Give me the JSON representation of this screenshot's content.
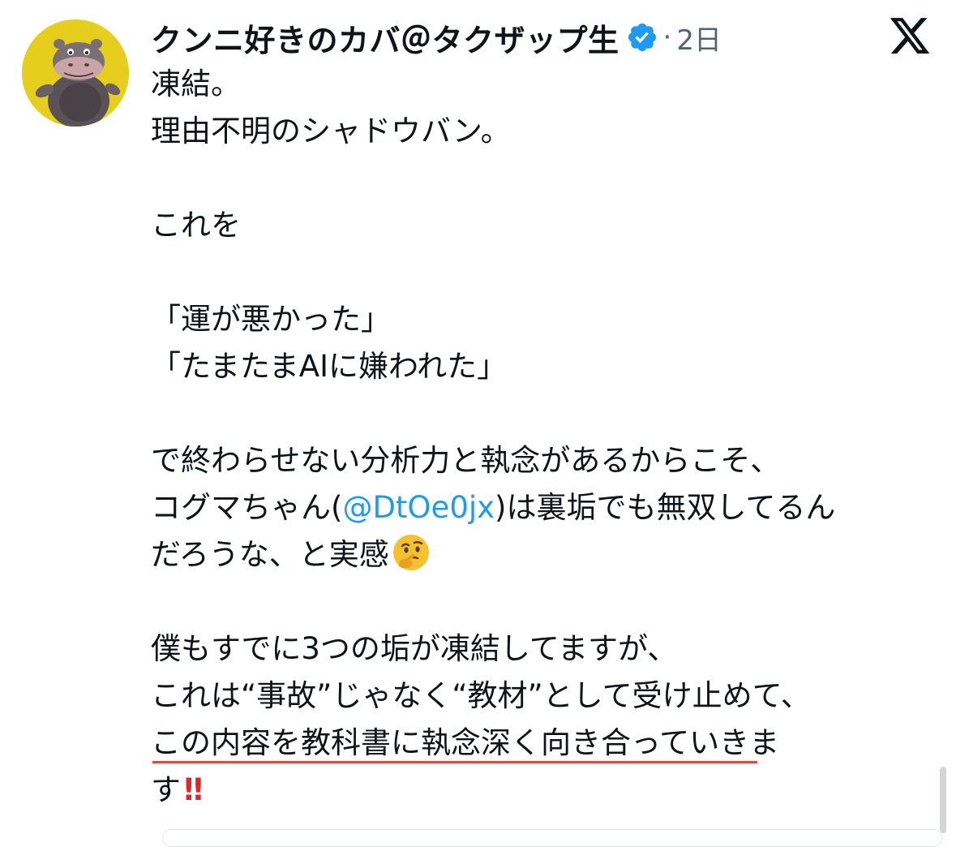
{
  "author": {
    "display_name": "クンニ好きのカバ＠タクザップ生",
    "verified_icon": "verified-badge-icon",
    "avatar_icon": "hippo-avatar"
  },
  "meta": {
    "separator": "·",
    "time": "2日"
  },
  "brand": {
    "logo_icon": "x-logo-icon"
  },
  "tweet": {
    "lines": [
      "凍結。",
      "理由不明のシャドウバン。",
      "",
      "これを",
      "",
      "「運が悪かった」",
      "「たまたまAIに嫌われた」",
      "",
      "で終わらせない分析力と執念があるからこそ、",
      "",
      "だろうな、と実感",
      "",
      "僕もすでに3つの垢が凍結してますが、",
      "これは“事故”じゃなく“教材”として受け止めて、",
      "この内容を教科書に執念深く向き合っていきま",
      "す"
    ],
    "mention_line": {
      "before": "コグマちゃん(",
      "mention": "@DtOe0jx",
      "after": ")は裏垢でも無双してるん"
    },
    "thinking_emoji": "thinking-face-icon",
    "bangbang": "‼"
  },
  "colors": {
    "accent": "#1d9bf0",
    "text": "#0f1419",
    "muted": "#536471",
    "underline": "#e8453c",
    "bangbang": "#e0262c",
    "avatar_bg": "#e6cf1c"
  }
}
